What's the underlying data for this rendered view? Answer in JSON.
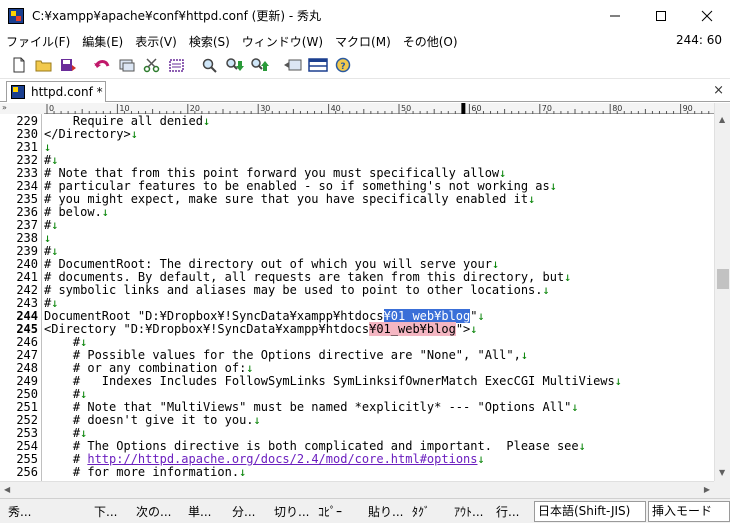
{
  "window": {
    "title": "C:¥xampp¥apache¥conf¥httpd.conf (更新) - 秀丸",
    "minimize": "—",
    "maximize": "☐",
    "close": "✕"
  },
  "menu": {
    "items": [
      "ファイル(F)",
      "編集(E)",
      "表示(V)",
      "検索(S)",
      "ウィンドウ(W)",
      "マクロ(M)",
      "その他(O)"
    ],
    "cursor_position": "244: 60"
  },
  "tab": {
    "label": "httpd.conf *",
    "close": "×"
  },
  "ruler": {
    "prefix": "»",
    "labels": [
      "0",
      "10",
      "20",
      "30",
      "40",
      "50",
      "60",
      "70",
      "80",
      "90"
    ]
  },
  "editor": {
    "lines": [
      {
        "n": "229",
        "text": "    Require all denied",
        "nl": "↓"
      },
      {
        "n": "230",
        "text": "</Directory>",
        "nl": "↓"
      },
      {
        "n": "231",
        "text": "",
        "nl": "↓"
      },
      {
        "n": "232",
        "text": "#",
        "nl": "↓"
      },
      {
        "n": "233",
        "text": "# Note that from this point forward you must specifically allow",
        "nl": "↓"
      },
      {
        "n": "234",
        "text": "# particular features to be enabled - so if something's not working as",
        "nl": "↓"
      },
      {
        "n": "235",
        "text": "# you might expect, make sure that you have specifically enabled it",
        "nl": "↓"
      },
      {
        "n": "236",
        "text": "# below.",
        "nl": "↓"
      },
      {
        "n": "237",
        "text": "#",
        "nl": "↓"
      },
      {
        "n": "238",
        "text": "",
        "nl": "↓"
      },
      {
        "n": "239",
        "text": "#",
        "nl": "↓"
      },
      {
        "n": "240",
        "text": "# DocumentRoot: The directory out of which you will serve your",
        "nl": "↓"
      },
      {
        "n": "241",
        "text": "# documents. By default, all requests are taken from this directory, but",
        "nl": "↓"
      },
      {
        "n": "242",
        "text": "# symbolic links and aliases may be used to point to other locations.",
        "nl": "↓"
      },
      {
        "n": "243",
        "text": "#",
        "nl": "↓"
      },
      {
        "n": "244",
        "pre": "DocumentRoot \"D:¥Dropbox¥!SyncData¥xampp¥htdocs",
        "sel": "¥01_web¥blog",
        "post": "\"",
        "nl": "↓",
        "bold": true
      },
      {
        "n": "245",
        "pre": "<Directory \"D:¥Dropbox¥!SyncData¥xampp¥htdocs",
        "find": "¥01_web¥blog",
        "post": "\">",
        "nl": "↓",
        "bold": true
      },
      {
        "n": "246",
        "text": "    #",
        "nl": "↓"
      },
      {
        "n": "247",
        "text": "    # Possible values for the Options directive are \"None\", \"All\",",
        "nl": "↓"
      },
      {
        "n": "248",
        "text": "    # or any combination of:",
        "nl": "↓"
      },
      {
        "n": "249",
        "text": "    #   Indexes Includes FollowSymLinks SymLinksifOwnerMatch ExecCGI MultiViews",
        "nl": "↓"
      },
      {
        "n": "250",
        "text": "    #",
        "nl": "↓"
      },
      {
        "n": "251",
        "text": "    # Note that \"MultiViews\" must be named *explicitly* --- \"Options All\"",
        "nl": "↓"
      },
      {
        "n": "252",
        "text": "    # doesn't give it to you.",
        "nl": "↓"
      },
      {
        "n": "253",
        "text": "    #",
        "nl": "↓"
      },
      {
        "n": "254",
        "text": "    # The Options directive is both complicated and important.  Please see",
        "nl": "↓"
      },
      {
        "n": "255",
        "pre": "    # ",
        "url": "http://httpd.apache.org/docs/2.4/mod/core.html#options",
        "nl": "↓"
      },
      {
        "n": "256",
        "text": "    # for more information.",
        "nl": "↓"
      }
    ]
  },
  "function_keys": {
    "items": [
      "秀...",
      "下...",
      "次の...",
      "単...",
      "分...",
      "切り...",
      "ｺﾋﾟｰ",
      "貼り...",
      "ﾀｸﾞ",
      "ｱｳﾄ...",
      "行..."
    ],
    "encoding": "日本語(Shift-JIS)",
    "mode": "挿入モード"
  },
  "colors": {
    "selection": "#3a6fd8",
    "find_highlight": "#f4b6c2",
    "newline_mark": "#008000",
    "url": "#6b1fbf"
  }
}
